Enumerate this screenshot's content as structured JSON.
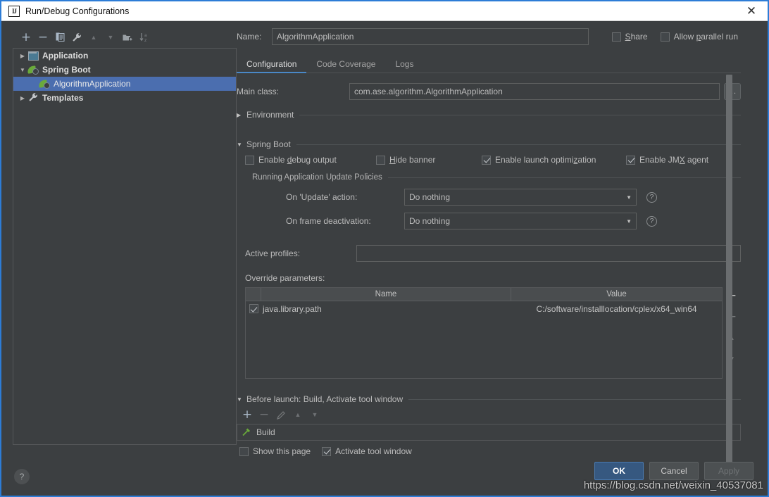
{
  "window": {
    "title": "Run/Debug Configurations",
    "app_icon": "intellij-idea-icon",
    "close_label": "✕"
  },
  "tree_toolbar": {
    "buttons": [
      {
        "name": "add-configuration-button",
        "glyph": "+"
      },
      {
        "name": "remove-configuration-button",
        "glyph": "−"
      },
      {
        "name": "copy-configuration-button",
        "glyph": "❐"
      },
      {
        "name": "edit-templates-button",
        "glyph": "🔧"
      },
      {
        "name": "move-up-button",
        "glyph": "▲"
      },
      {
        "name": "move-down-button",
        "glyph": "▼"
      },
      {
        "name": "move-into-folder-button",
        "glyph": "📁"
      },
      {
        "name": "sort-alphabetically-button",
        "glyph": "↓az"
      }
    ]
  },
  "tree": {
    "items": [
      {
        "label": "Application",
        "icon": "application-icon",
        "arrow": "▶",
        "bold": true,
        "selected": false,
        "indent": 0
      },
      {
        "label": "Spring Boot",
        "icon": "spring-leaf-icon",
        "arrow": "▼",
        "bold": true,
        "selected": false,
        "indent": 0
      },
      {
        "label": "AlgorithmApplication",
        "icon": "spring-leaf-icon",
        "arrow": "",
        "bold": false,
        "selected": true,
        "indent": 1
      },
      {
        "label": "Templates",
        "icon": "wrench-icon",
        "arrow": "▶",
        "bold": true,
        "selected": false,
        "indent": 0
      }
    ]
  },
  "header": {
    "name_label": "Name:",
    "name_value": "AlgorithmApplication",
    "share_label": "Share",
    "share_checked": false,
    "parallel_label": "Allow parallel run",
    "parallel_checked": false
  },
  "tabs": [
    {
      "label": "Configuration",
      "active": true
    },
    {
      "label": "Code Coverage",
      "active": false
    },
    {
      "label": "Logs",
      "active": false
    }
  ],
  "configuration": {
    "main_class_label": "Main class:",
    "main_class_value": "com.ase.algorithm.AlgorithmApplication",
    "browse_label": "...",
    "environment_section": {
      "title": "Environment",
      "expanded": false,
      "arrow": "▶"
    },
    "spring_boot_section": {
      "title": "Spring Boot",
      "expanded": true,
      "arrow": "▼",
      "checkboxes": [
        {
          "label": "Enable debug output",
          "checked": false,
          "mnemonic": "d"
        },
        {
          "label": "Hide banner",
          "checked": false,
          "mnemonic": "H"
        },
        {
          "label": "Enable launch optimization",
          "checked": true,
          "mnemonic": "z"
        },
        {
          "label": "Enable JMX agent",
          "checked": true,
          "mnemonic": "X"
        }
      ],
      "update_policies_title": "Running Application Update Policies",
      "policies": [
        {
          "label": "On 'Update' action:",
          "value": "Do nothing",
          "help": "?"
        },
        {
          "label": "On frame deactivation:",
          "value": "Do nothing",
          "help": "?"
        }
      ],
      "active_profiles_label": "Active profiles:",
      "active_profiles_value": "",
      "override_parameters_label": "Override parameters:"
    },
    "override_table": {
      "columns": [
        "",
        "Name",
        "Value"
      ],
      "rows": [
        {
          "enabled": true,
          "name": "java.library.path",
          "value": "C:/software/installlocation/cplex/x64_win64"
        }
      ],
      "side_buttons": [
        {
          "name": "add-parameter-button",
          "glyph": "+"
        },
        {
          "name": "remove-parameter-button",
          "glyph": "−"
        },
        {
          "name": "move-parameter-up-button",
          "glyph": "▲"
        },
        {
          "name": "move-parameter-down-button",
          "glyph": "▼"
        }
      ]
    }
  },
  "before_launch": {
    "title": "Before launch: Build, Activate tool window",
    "arrow": "▼",
    "toolbar": [
      {
        "name": "add-task-button",
        "glyph": "+"
      },
      {
        "name": "remove-task-button",
        "glyph": "−"
      },
      {
        "name": "edit-task-button",
        "glyph": "✎"
      },
      {
        "name": "task-up-button",
        "glyph": "▲"
      },
      {
        "name": "task-down-button",
        "glyph": "▼"
      }
    ],
    "tasks": [
      {
        "label": "Build",
        "icon": "hammer-icon"
      }
    ],
    "show_page_label": "Show this page",
    "show_page_checked": false,
    "activate_tool_window_label": "Activate tool window",
    "activate_tool_window_checked": true
  },
  "footer": {
    "help_label": "?",
    "ok_label": "OK",
    "cancel_label": "Cancel",
    "apply_label": "Apply"
  },
  "watermark": {
    "text": "https://blog.csdn.net/weixin_40537081"
  },
  "colors": {
    "dialog_bg": "#3c3f41",
    "titlebar_bg": "#ffffff",
    "accent_border": "#2d7cd6",
    "selection_blue": "#4b6eaf",
    "tab_underline": "#4a88c7",
    "ok_button": "#365880",
    "spring_green": "#6aaa3a"
  }
}
